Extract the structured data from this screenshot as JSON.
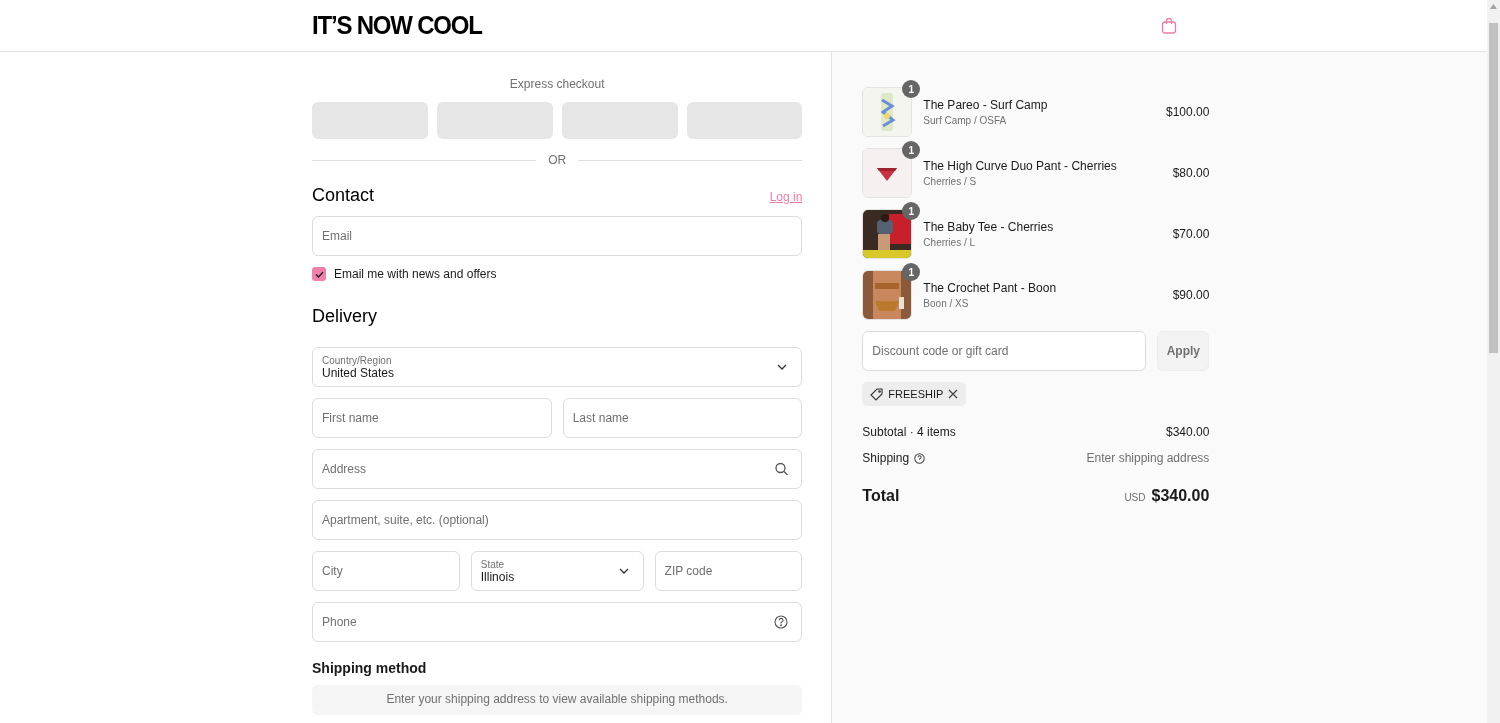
{
  "header": {
    "logo": "IT’S NOW COOL"
  },
  "express_checkout": {
    "label": "Express checkout",
    "buttons": [
      {
        "kind": "wallet"
      },
      {
        "kind": "wallet"
      },
      {
        "kind": "wallet"
      },
      {
        "kind": "wallet"
      }
    ],
    "divider": "OR"
  },
  "contact": {
    "title": "Contact",
    "login_link": "Log in",
    "email": {
      "placeholder": "Email"
    },
    "newsletter": {
      "label": "Email me with news and offers",
      "checked": true
    }
  },
  "delivery": {
    "title": "Delivery",
    "rows": [
      [
        {
          "kind": "select",
          "label": "Country/Region",
          "value": "United States"
        }
      ],
      [
        {
          "kind": "text",
          "placeholder": "First name"
        },
        {
          "kind": "text",
          "placeholder": "Last name"
        }
      ],
      [
        {
          "kind": "search",
          "placeholder": "Address"
        }
      ],
      [
        {
          "kind": "text",
          "placeholder": "Apartment, suite, etc. (optional)"
        }
      ],
      [
        {
          "kind": "text",
          "placeholder": "City"
        },
        {
          "kind": "select",
          "label": "State",
          "value": "Illinois"
        },
        {
          "kind": "text",
          "placeholder": "ZIP code"
        }
      ],
      [
        {
          "kind": "help",
          "placeholder": "Phone"
        }
      ]
    ]
  },
  "shipping_method": {
    "title": "Shipping method",
    "notice": "Enter your shipping address to view available shipping methods."
  },
  "cart": {
    "items": [
      {
        "name": "The Pareo - Surf Camp",
        "variant": "Surf Camp / OSFA",
        "price": "$100.00",
        "quantity": "1"
      },
      {
        "name": "The High Curve Duo Pant - Cherries",
        "variant": "Cherries / S",
        "price": "$80.00",
        "quantity": "1"
      },
      {
        "name": "The Baby Tee - Cherries",
        "variant": "Cherries / L",
        "price": "$70.00",
        "quantity": "1"
      },
      {
        "name": "The Crochet Pant - Boon",
        "variant": "Boon / XS",
        "price": "$90.00",
        "quantity": "1"
      }
    ]
  },
  "discount": {
    "placeholder": "Discount code or gift card",
    "button": "Apply",
    "applied": [
      {
        "code": "FREESHIP"
      }
    ]
  },
  "summary": {
    "subtotal": {
      "label": "Subtotal · 4 items",
      "value": "$340.00"
    },
    "shipping": {
      "label": "Shipping",
      "value": "Enter shipping address"
    },
    "total": {
      "label": "Total",
      "currency": "USD",
      "value": "$340.00"
    }
  }
}
